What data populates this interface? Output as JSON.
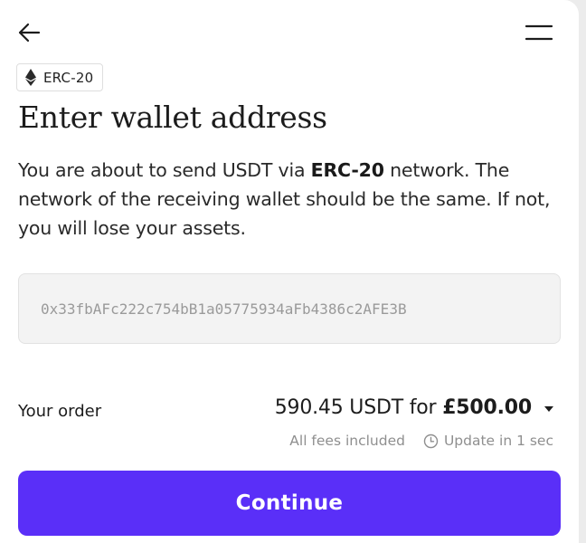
{
  "header": {
    "back_icon": "arrow-left-icon",
    "menu_icon": "menu-icon"
  },
  "network_chip": {
    "icon": "ethereum-icon",
    "label": "ERC-20"
  },
  "title": "Enter wallet address",
  "description": {
    "part1": "You are about to send USDT via ",
    "network": "ERC-20",
    "part2": " network. The network of the receiving wallet should be the same. If not, you will lose your assets."
  },
  "address_input": {
    "value": "",
    "placeholder": "0x33fbAFc222c754bB1a05775934aFb4386c2AFE3B"
  },
  "order": {
    "label": "Your order",
    "crypto_amount": "590.45 USDT for ",
    "fiat_amount": "£500.00",
    "fees_text": "All fees included",
    "update_text": "Update in 1 sec"
  },
  "continue_button": {
    "label": "Continue"
  },
  "colors": {
    "accent": "#5a2ff8",
    "input_bg": "#f3f3f3",
    "muted_text": "#8f8f8f"
  }
}
